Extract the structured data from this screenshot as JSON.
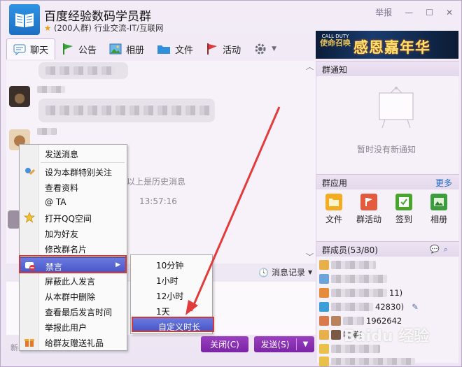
{
  "window": {
    "group_name": "百度经验数码学员群",
    "group_size": "(200人群)",
    "group_category": "行业交流-IT/互联网",
    "report_label": "举报"
  },
  "tabs": [
    {
      "label": "聊天",
      "icon": "chat-icon"
    },
    {
      "label": "公告",
      "icon": "announcement-flag-icon"
    },
    {
      "label": "相册",
      "icon": "photo-album-icon"
    },
    {
      "label": "文件",
      "icon": "folder-icon"
    },
    {
      "label": "活动",
      "icon": "activity-flag-icon"
    }
  ],
  "banner": {
    "logo_top": "CALL·DUTY",
    "logo_brand": "使命召唤",
    "text": "感恩嘉年华"
  },
  "chat": {
    "history_divider": "以上是历史消息",
    "timestamp": "13:57:16",
    "message_record": "消息记录"
  },
  "context_menu": {
    "items": [
      {
        "label": "发送消息",
        "icon": ""
      },
      {
        "label": "设为本群特别关注",
        "icon": "special-follow-icon"
      },
      {
        "label": "查看资料",
        "icon": ""
      },
      {
        "label": "@ TA",
        "icon": ""
      },
      {
        "label": "打开QQ空间",
        "icon": "qzone-star-icon"
      },
      {
        "label": "加为好友",
        "icon": ""
      },
      {
        "label": "修改群名片",
        "icon": ""
      },
      {
        "label": "禁言",
        "icon": "mute-icon",
        "highlighted": true
      },
      {
        "label": "屏蔽此人发言",
        "icon": ""
      },
      {
        "label": "从本群中删除",
        "icon": ""
      },
      {
        "label": "查看最后发言时间",
        "icon": ""
      },
      {
        "label": "举报此用户",
        "icon": ""
      },
      {
        "label": "给群友赠送礼品",
        "icon": "gift-icon"
      }
    ]
  },
  "mute_submenu": {
    "items": [
      "10分钟",
      "1小时",
      "12小时",
      "1天",
      "自定义时长"
    ],
    "selected": "自定义时长"
  },
  "buttons": {
    "close": "关闭(C)",
    "send": "发送(S)"
  },
  "right_panel": {
    "notice_title": "群通知",
    "notice_empty": "暂时没有新通知",
    "apps_title": "群应用",
    "apps_more": "更多",
    "apps": [
      {
        "label": "文件",
        "icon": "file-app-icon",
        "color": "#f2a316"
      },
      {
        "label": "群活动",
        "icon": "group-activity-icon",
        "color": "#d9453a"
      },
      {
        "label": "签到",
        "icon": "checkin-icon",
        "color": "#4aa52f"
      },
      {
        "label": "相册",
        "icon": "album-app-icon",
        "color": "#3c9d3c"
      }
    ],
    "members_title": "群成员(53/80)",
    "members": [
      {
        "name": "",
        "tail": ""
      },
      {
        "name": "",
        "tail": ""
      },
      {
        "name": "",
        "tail": "11)"
      },
      {
        "name": "",
        "tail": "42830)"
      },
      {
        "name": "",
        "tail": "19626​42"
      },
      {
        "name": "咗曦(",
        "tail": ""
      },
      {
        "name": "",
        "tail": ""
      },
      {
        "name": "",
        "tail": ""
      }
    ]
  },
  "watermark": "Baidu 经验",
  "bottom_tip": "新手开启 已安装插件"
}
